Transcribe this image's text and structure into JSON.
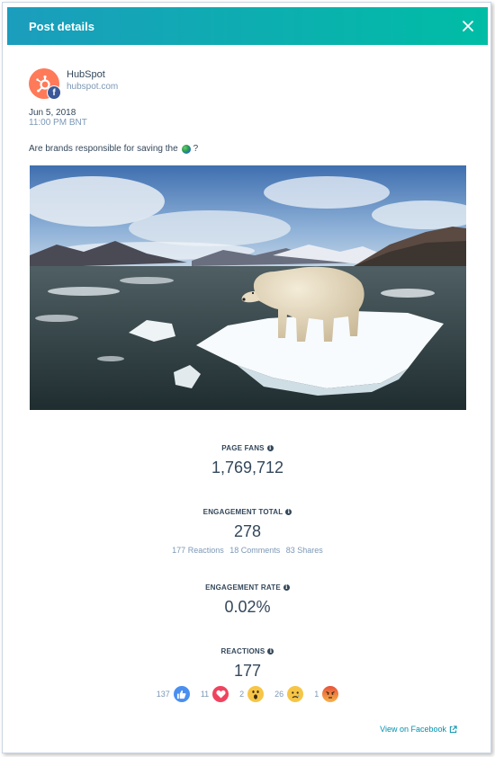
{
  "header": {
    "title": "Post details"
  },
  "account": {
    "name": "HubSpot",
    "url": "hubspot.com"
  },
  "post": {
    "date": "Jun 5, 2018",
    "time": "11:00 PM BNT",
    "text_before": "Are brands responsible for saving the",
    "text_after": "?"
  },
  "stats": {
    "page_fans": {
      "label": "PAGE FANS",
      "value": "1,769,712"
    },
    "engagement_total": {
      "label": "ENGAGEMENT TOTAL",
      "value": "278",
      "reactions_link": "177 Reactions",
      "comments_link": "18 Comments",
      "shares_link": "83 Shares"
    },
    "engagement_rate": {
      "label": "ENGAGEMENT RATE",
      "value": "0.02%"
    },
    "reactions": {
      "label": "REACTIONS",
      "value": "177"
    }
  },
  "reactions": [
    {
      "type": "like",
      "count": "137"
    },
    {
      "type": "love",
      "count": "11"
    },
    {
      "type": "wow",
      "count": "2"
    },
    {
      "type": "sad",
      "count": "26"
    },
    {
      "type": "angry",
      "count": "1"
    }
  ],
  "footer": {
    "view_link": "View on Facebook"
  },
  "colors": {
    "header_start": "#1b9dbd",
    "header_end": "#00bda5",
    "brand": "#ff7a59",
    "link": "#0091ae"
  }
}
